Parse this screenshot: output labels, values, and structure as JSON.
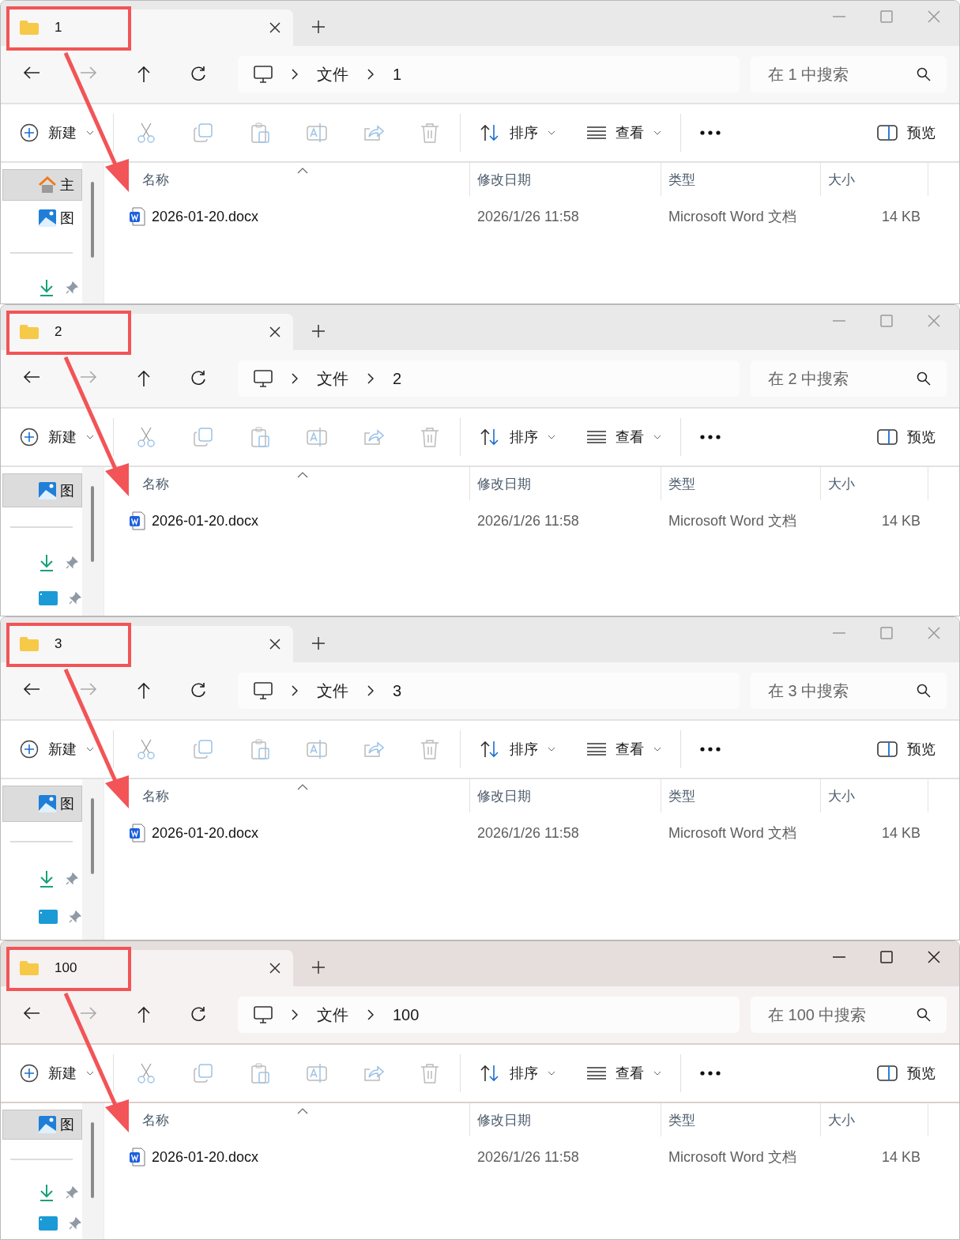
{
  "windows": [
    {
      "active": false,
      "annotated": true,
      "tab": {
        "label": "1",
        "selected": true
      },
      "breadcrumb": [
        "文件",
        "1"
      ],
      "search": {
        "placeholder": "在 1 中搜索"
      },
      "toolbar": {
        "new": "新建",
        "sort": "排序",
        "view": "查看",
        "preview": "预览"
      },
      "sidebar": [
        {
          "kind": "home",
          "label": "主",
          "selected": true
        },
        {
          "kind": "pictures",
          "label": "图",
          "selected": false
        },
        {
          "kind": "divider"
        },
        {
          "kind": "downloads",
          "pinned": true
        }
      ],
      "columns": [
        "名称",
        "修改日期",
        "类型",
        "大小"
      ],
      "rows": [
        {
          "name": "2026-01-20.docx",
          "modified": "2026/1/26 11:58",
          "type": "Microsoft Word 文档",
          "size": "14 KB"
        }
      ]
    },
    {
      "active": false,
      "annotated": true,
      "tab": {
        "label": "2",
        "selected": true
      },
      "breadcrumb": [
        "文件",
        "2"
      ],
      "search": {
        "placeholder": "在 2 中搜索"
      },
      "toolbar": {
        "new": "新建",
        "sort": "排序",
        "view": "查看",
        "preview": "预览"
      },
      "sidebar": [
        {
          "kind": "pictures",
          "label": "图",
          "selected": true
        },
        {
          "kind": "divider"
        },
        {
          "kind": "downloads",
          "pinned": true
        },
        {
          "kind": "desktop",
          "pinned": true
        }
      ],
      "columns": [
        "名称",
        "修改日期",
        "类型",
        "大小"
      ],
      "rows": [
        {
          "name": "2026-01-20.docx",
          "modified": "2026/1/26 11:58",
          "type": "Microsoft Word 文档",
          "size": "14 KB"
        }
      ]
    },
    {
      "active": false,
      "annotated": true,
      "tab": {
        "label": "3",
        "selected": true
      },
      "breadcrumb": [
        "文件",
        "3"
      ],
      "search": {
        "placeholder": "在 3 中搜索"
      },
      "toolbar": {
        "new": "新建",
        "sort": "排序",
        "view": "查看",
        "preview": "预览"
      },
      "sidebar": [
        {
          "kind": "pictures",
          "label": "图",
          "selected": true
        },
        {
          "kind": "divider"
        },
        {
          "kind": "downloads",
          "pinned": true
        },
        {
          "kind": "desktop",
          "pinned": true
        }
      ],
      "columns": [
        "名称",
        "修改日期",
        "类型",
        "大小"
      ],
      "rows": [
        {
          "name": "2026-01-20.docx",
          "modified": "2026/1/26 11:58",
          "type": "Microsoft Word 文档",
          "size": "14 KB"
        }
      ]
    },
    {
      "active": true,
      "annotated": true,
      "tab": {
        "label": "100",
        "selected": true
      },
      "breadcrumb": [
        "文件",
        "100"
      ],
      "search": {
        "placeholder": "在 100 中搜索"
      },
      "toolbar": {
        "new": "新建",
        "sort": "排序",
        "view": "查看",
        "preview": "预览"
      },
      "sidebar": [
        {
          "kind": "pictures",
          "label": "图",
          "selected": true
        },
        {
          "kind": "divider"
        },
        {
          "kind": "downloads",
          "pinned": true
        },
        {
          "kind": "desktop",
          "pinned": true
        }
      ],
      "columns": [
        "名称",
        "修改日期",
        "类型",
        "大小"
      ],
      "rows": [
        {
          "name": "2026-01-20.docx",
          "modified": "2026/1/26 11:58",
          "type": "Microsoft Word 文档",
          "size": "14 KB"
        }
      ]
    }
  ]
}
